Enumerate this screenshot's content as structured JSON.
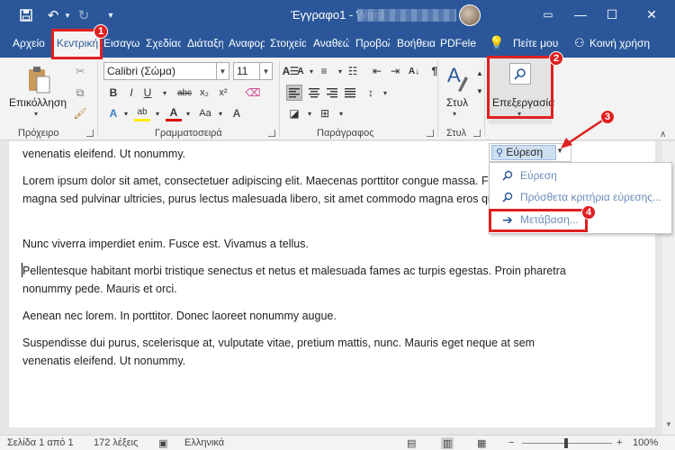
{
  "titlebar": {
    "title": "Έγγραφο1  -  Word",
    "icons": [
      "save-icon",
      "undo-icon",
      "redo-icon",
      "customize-icon"
    ],
    "window_buttons": {
      "ribbon_display": "▭",
      "minimize": "—",
      "maximize": "☐",
      "close": "✕"
    }
  },
  "tabs": [
    {
      "label": "Αρχείο"
    },
    {
      "label": "Κεντρική"
    },
    {
      "label": "Εισαγωγή"
    },
    {
      "label": "Σχεδίαση"
    },
    {
      "label": "Διάταξη"
    },
    {
      "label": "Αναφορές"
    },
    {
      "label": "Στοιχεία"
    },
    {
      "label": "Αναθεώρηση"
    },
    {
      "label": "Προβολή"
    },
    {
      "label": "Βοήθεια"
    },
    {
      "label": "PDFelement"
    }
  ],
  "tell_me": "Πείτε μου",
  "share": "Κοινή χρήση",
  "ribbon": {
    "clipboard": {
      "paste_label": "Επικόλληση",
      "group": "Πρόχειρο"
    },
    "font": {
      "font_name": "Calibri (Σώμα)",
      "font_size": "11",
      "group": "Γραμματοσειρά",
      "bold": "B",
      "italic": "I",
      "underline": "U",
      "strike": "abc",
      "sub": "x₂",
      "sup": "x²",
      "grow": "A",
      "shrink": "A",
      "case": "Aa",
      "highlight": "ab",
      "color": "A"
    },
    "paragraph": {
      "group": "Παράγραφος",
      "sort": "A↓",
      "marks": "¶"
    },
    "styles": {
      "label": "Στυλ",
      "group": "Στυλ"
    },
    "editing": {
      "label": "Επεξεργασία"
    }
  },
  "document": {
    "paragraphs": [
      "venenatis eleifend. Ut nonummy.",
      "Lorem ipsum dolor sit amet, consectetuer adipiscing elit. Maecenas porttitor congue massa. Fusce posuere, magna sed pulvinar ultricies, purus lectus malesuada libero, sit amet commodo magna eros quis urna.",
      "Nunc viverra imperdiet enim. Fusce est. Vivamus a tellus.",
      "Pellentesque habitant morbi tristique senectus et netus et malesuada fames ac turpis egestas. Proin pharetra nonummy pede. Mauris et orci.",
      "Aenean nec lorem. In porttitor. Donec laoreet nonummy augue.",
      "Suspendisse dui purus, scelerisque at, vulputate vitae, pretium mattis, nunc. Mauris eget neque at sem venenatis eleifend. Ut nonummy."
    ]
  },
  "dropdown": {
    "split_label": "Εύρεση",
    "items": [
      {
        "label": "Εύρεση",
        "icon": "search-icon"
      },
      {
        "label": "Πρόσθετα κριτήρια εύρεσης...",
        "icon": "search-icon"
      },
      {
        "label": "Μετάβαση...",
        "icon": "arrow-right-icon"
      }
    ]
  },
  "statusbar": {
    "page": "Σελίδα 1 από 1",
    "words": "172 λέξεις",
    "language": "Ελληνικά",
    "zoom": "100%"
  },
  "badges": [
    "1",
    "2",
    "3",
    "4"
  ],
  "colors": {
    "brand": "#2b579a",
    "annotation": "#e02020",
    "tab_bg": "#f3f3f3"
  }
}
